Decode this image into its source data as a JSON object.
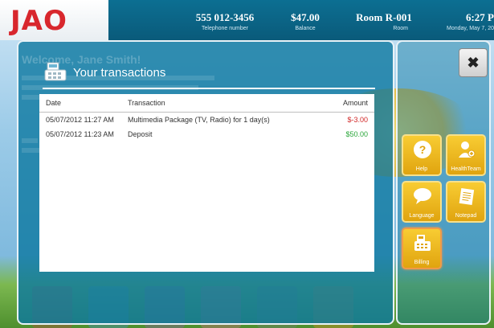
{
  "header": {
    "logo": "JAO",
    "phone": {
      "value": "555 012-3456",
      "label": "Telephone number"
    },
    "balance": {
      "value": "$47.00",
      "label": "Balance"
    },
    "room": {
      "value": "Room R-001",
      "label": "Room"
    },
    "time": {
      "value": "6:27 P",
      "label": "Monday, May 7, 20"
    }
  },
  "background": {
    "welcome": "Welcome, Jane Smith!"
  },
  "panel": {
    "title": "Your transactions",
    "icon": "cash-register-icon",
    "table": {
      "columns": [
        "Date",
        "Transaction",
        "Amount"
      ],
      "rows": [
        {
          "date": "05/07/2012 11:27 AM",
          "transaction": "Multimedia Package (TV, Radio) for 1 day(s)",
          "amount": "$-3.00",
          "status": "negative"
        },
        {
          "date": "05/07/2012 11:23 AM",
          "transaction": "Deposit",
          "amount": "$50.00",
          "status": "positive"
        }
      ]
    }
  },
  "dock": {
    "close_icon": "close-icon",
    "tiles": [
      {
        "label": "Help",
        "icon": "help-icon"
      },
      {
        "label": "HealthTeam",
        "icon": "health-team-icon"
      },
      {
        "label": "Language",
        "icon": "language-icon"
      },
      {
        "label": "Notepad",
        "icon": "notepad-icon"
      },
      {
        "label": "Billing",
        "icon": "billing-icon"
      }
    ]
  },
  "colors": {
    "topbar": "#0c6f92",
    "logo": "#d8272d",
    "tile": "#f8cc33",
    "negative": "#d12626",
    "positive": "#2aa63a"
  }
}
